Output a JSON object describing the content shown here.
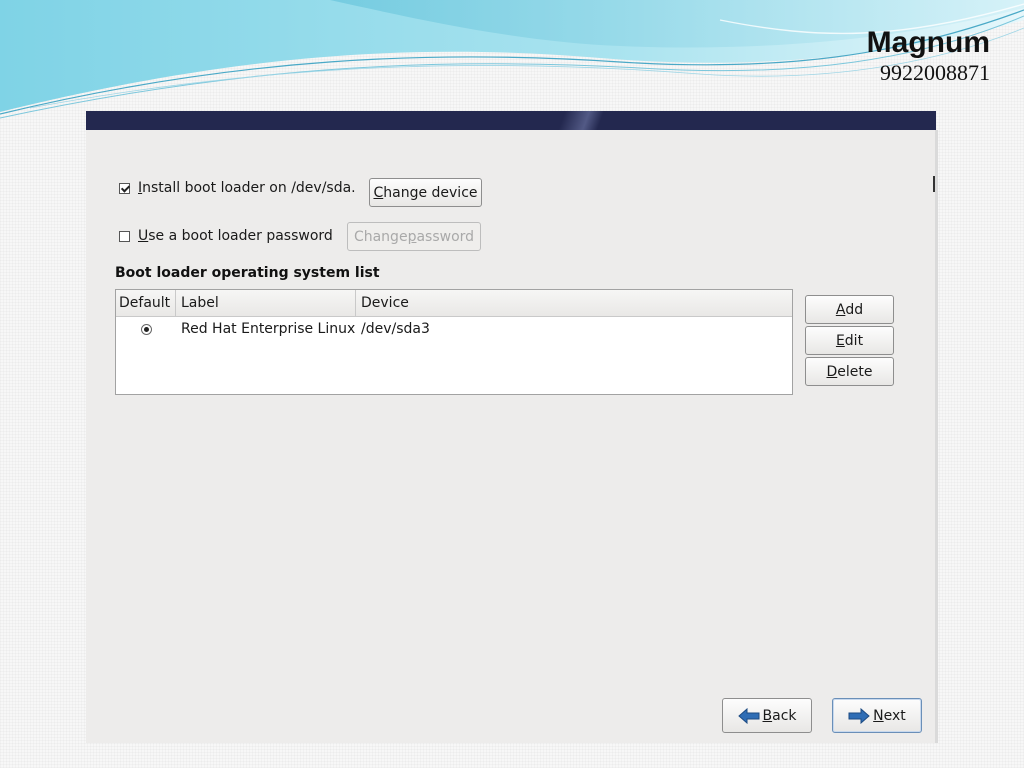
{
  "slide": {
    "brand_name": "Magnum",
    "brand_phone": "9922008871"
  },
  "window": {
    "install_bootloader": {
      "label_pre": "",
      "label_mnemonic": "I",
      "label_post": "nstall boot loader on /dev/sda.",
      "checked": true,
      "button_pre": "",
      "button_mnemonic": "C",
      "button_post": "hange device"
    },
    "password": {
      "label_pre": "",
      "label_mnemonic": "U",
      "label_post": "se a boot loader password",
      "checked": false,
      "button_pre": "Change ",
      "button_mnemonic": "p",
      "button_post": "assword"
    },
    "os_list": {
      "title": "Boot loader operating system list",
      "columns": [
        "Default",
        "Label",
        "Device"
      ],
      "rows": [
        {
          "default": true,
          "label": "Red Hat Enterprise Linux",
          "device": "/dev/sda3"
        }
      ]
    },
    "side_buttons": [
      {
        "mnemonic": "A",
        "rest": "dd"
      },
      {
        "mnemonic": "E",
        "rest": "dit"
      },
      {
        "mnemonic": "D",
        "rest": "elete"
      }
    ],
    "nav": {
      "back": {
        "mnemonic": "B",
        "rest": "ack",
        "icon": "arrow-left-icon"
      },
      "next": {
        "mnemonic": "N",
        "rest": "ext",
        "icon": "arrow-right-icon"
      }
    },
    "colors": {
      "title_band": "#23284f",
      "window_bg": "#edeceb",
      "arrow_blue": "#2f6db5"
    }
  }
}
